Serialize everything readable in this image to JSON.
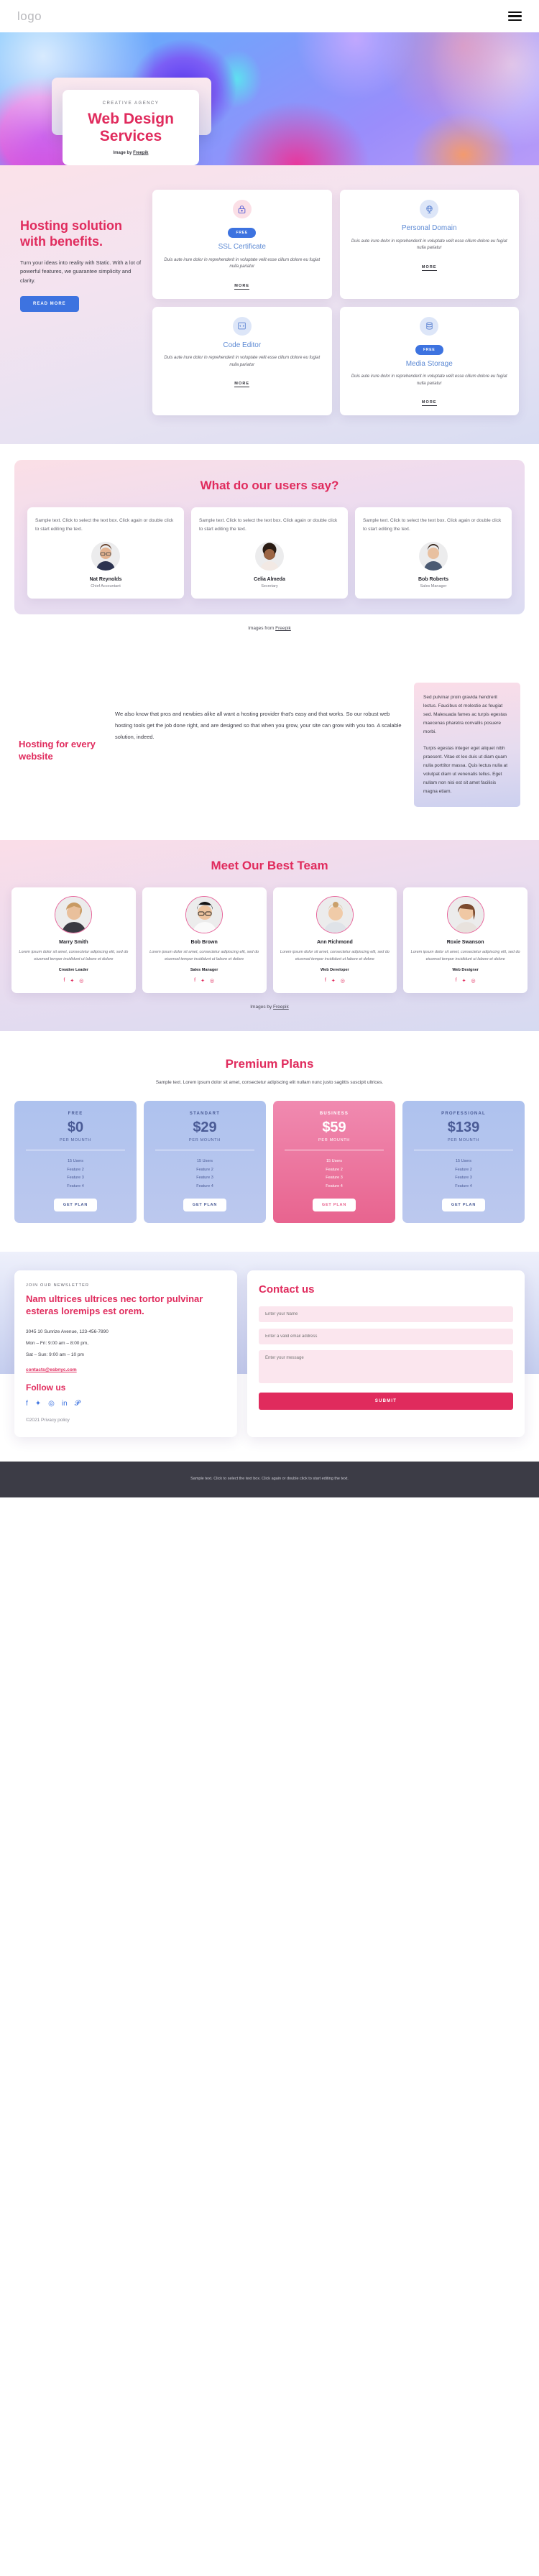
{
  "header": {
    "logo": "logo",
    "menu_label": "menu"
  },
  "hero": {
    "eyebrow": "CREATIVE AGENCY",
    "title_line1": "Web Design",
    "title_line2": "Services",
    "credit_prefix": "Image by ",
    "credit_link": "Freepik"
  },
  "hosting": {
    "title": "Hosting solution with benefits.",
    "copy": "Turn your ideas into reality with Static. With a lot of powerful features, we guarantee simplicity and clarity.",
    "button": "READ MORE",
    "cards": [
      {
        "icon": "lock-icon",
        "badge": "FREE",
        "title": "SSL Certificate",
        "desc": "Duis aute irure dolor in reprehenderit in voluptate velit esse cillum dolore eu fugiat nulla pariatur",
        "more": "MORE"
      },
      {
        "icon": "globe-icon",
        "badge": "",
        "title": "Personal Domain",
        "desc": "Duis aute irure dolor in reprehenderit in voluptate velit esse cillum dolore eu fugiat nulla pariatur",
        "more": "MORE"
      },
      {
        "icon": "code-icon",
        "badge": "",
        "title": "Code Editor",
        "desc": "Duis aute irure dolor in reprehenderit in voluptate velit esse cillum dolore eu fugiat nulla pariatur",
        "more": "MORE"
      },
      {
        "icon": "database-icon",
        "badge": "FREE",
        "title": "Media Storage",
        "desc": "Duis aute irure dolor in reprehenderit in voluptate velit esse cillum dolore eu fugiat nulla pariatur",
        "more": "MORE"
      }
    ]
  },
  "testimonials": {
    "title": "What do our users say?",
    "items": [
      {
        "text": "Sample text. Click to select the text box. Click again or double click to start editing the text.",
        "name": "Nat Reynolds",
        "role": "Chief Accountant"
      },
      {
        "text": "Sample text. Click to select the text box. Click again or double click to start editing the text.",
        "name": "Celia Almeda",
        "role": "Secretary"
      },
      {
        "text": "Sample text. Click to select the text box. Click again or double click to start editing the text.",
        "name": "Bob Roberts",
        "role": "Sales Manager"
      }
    ],
    "credit_prefix": "Images from ",
    "credit_link": "Freepik"
  },
  "every_website": {
    "title": "Hosting for every website",
    "middle": "We also know that pros and newbies alike all want a hosting provider that's easy and that works. So our robust web hosting tools get the job done right, and are designed so that when you grow, your site can grow with you too. A scalable solution, indeed.",
    "side_p1": "Sed pulvinar proin gravida hendrerit lectus. Faucibus et molestie ac feugiat sed. Malesuada fames ac turpis egestas maecenas pharetra convallis posuere morbi.",
    "side_p2": "Turpis egestas integer eget aliquet nibh praesent. Vitae et leo duis ut diam quam nulla porttitor massa. Quis lectus nulla at volutpat diam ut venenatis tellus. Eget nullam non nisi est sit amet facilisis magna etiam."
  },
  "team": {
    "title": "Meet Our Best Team",
    "members": [
      {
        "name": "Marry Smith",
        "desc": "Lorem ipsum dolor sit amet, consectetur adipiscing elit, sed do eiusmod tempor incididunt ut labore et dolore",
        "role": "Creative Leader"
      },
      {
        "name": "Bob Brown",
        "desc": "Lorem ipsum dolor sit amet, consectetur adipiscing elit, sed do eiusmod tempor incididunt ut labore et dolore",
        "role": "Sales Manager"
      },
      {
        "name": "Ann Richmond",
        "desc": "Lorem ipsum dolor sit amet, consectetur adipiscing elit, sed do eiusmod tempor incididunt ut labore et dolore",
        "role": "Web Developer"
      },
      {
        "name": "Roxie Swanson",
        "desc": "Lorem ipsum dolor sit amet, consectetur adipiscing elit, sed do eiusmod tempor incididunt ut labore et dolore",
        "role": "Web Designer"
      }
    ],
    "credit_prefix": "Images by ",
    "credit_link": "Freepik"
  },
  "pricing": {
    "title": "Premium Plans",
    "subtitle": "Sample text. Lorem ipsum dolor sit amet, consectetur adipiscing elit nullam nunc justo sagittis suscipit ultrices.",
    "plans": [
      {
        "name": "FREE",
        "price": "$0",
        "period": "PER MOUNTH",
        "features": [
          "15 Users",
          "Feature 2",
          "Feature 3",
          "Feature 4"
        ],
        "button": "GET PLAN",
        "highlight": "blue"
      },
      {
        "name": "STANDART",
        "price": "$29",
        "period": "PER MOUNTH",
        "features": [
          "15 Users",
          "Feature 2",
          "Feature 3",
          "Feature 4"
        ],
        "button": "GET PLAN",
        "highlight": "blue"
      },
      {
        "name": "BUSINESS",
        "price": "$59",
        "period": "PER MOUNTH",
        "features": [
          "15 Users",
          "Feature 2",
          "Feature 3",
          "Feature 4"
        ],
        "button": "GET PLAN",
        "highlight": "pink"
      },
      {
        "name": "PROFESSIONAL",
        "price": "$139",
        "period": "PER MOUNTH",
        "features": [
          "15 Users",
          "Feature 2",
          "Feature 3",
          "Feature 4"
        ],
        "button": "GET PLAN",
        "highlight": "blue"
      }
    ]
  },
  "footer": {
    "newsletter_eyebrow": "JOIN OUR NEWSLETTER",
    "newsletter_title": "Nam ultrices ultrices nec tortor pulvinar esteras loremips est orem.",
    "address": "3045 10 Sunrize Avenue, 123-456-7890",
    "hours_1": "Mon – Fri: 9:00 am – 8:00 pm,",
    "hours_2": "Sat – Sun: 9:00 am – 10 pm",
    "email": "contacts@esbnyc.com",
    "follow_title": "Follow us",
    "social": [
      "facebook-icon",
      "twitter-icon",
      "instagram-icon",
      "linkedin-icon",
      "pinterest-icon"
    ],
    "copyright": "©2021 Privacy policy",
    "contact_title": "Contact us",
    "name_placeholder": "Enter your Name",
    "email_placeholder": "Enter a valid email address",
    "message_placeholder": "Enter your message",
    "submit": "SUBMIT"
  },
  "bottombar": {
    "text": "Sample text. Click to select the text box. Click again or double click to start editing the text."
  },
  "colors": {
    "accent": "#e02b5d",
    "blue": "#3d73e0",
    "plan_blue": "#aec2ee",
    "plan_pink": "#e8648f"
  }
}
